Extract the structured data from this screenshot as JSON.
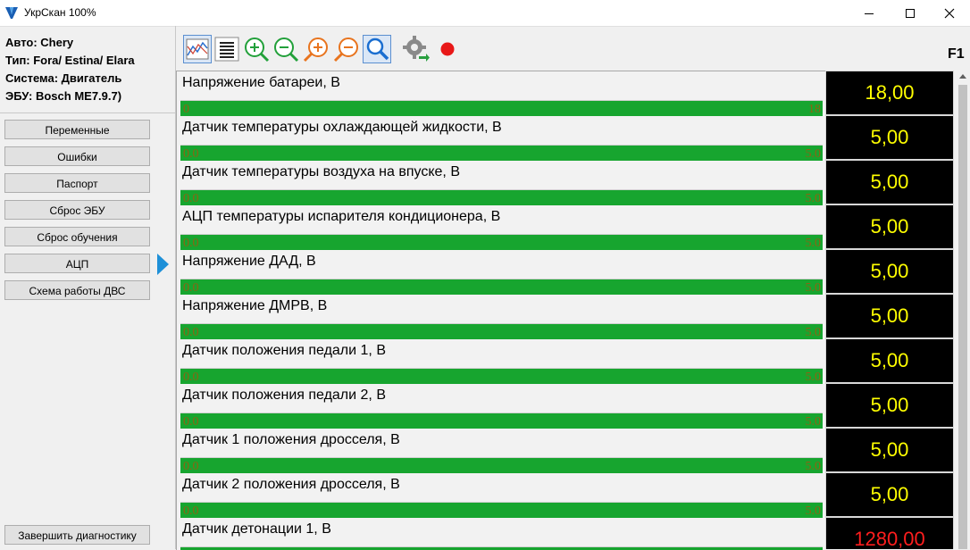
{
  "window": {
    "title": "УкрСкан 100%"
  },
  "info": {
    "auto": "Авто: Chery",
    "type": "Тип: Fora/ Estina/ Elara",
    "system": "Система: Двигатель",
    "ecu": "ЭБУ: Bosch ME7.9.7)"
  },
  "nav": {
    "items": [
      "Переменные",
      "Ошибки",
      "Паспорт",
      "Сброс ЭБУ",
      "Сброс обучения",
      "АЦП",
      "Схема работы ДВС"
    ],
    "selected_index": 5,
    "finish": "Завершить диагностику"
  },
  "toolbar": {
    "icons": [
      "graph-view-icon",
      "table-view-icon",
      "zoom-in-green-icon",
      "zoom-out-green-icon",
      "zoom-in-orange-icon",
      "zoom-out-orange-icon",
      "search-icon",
      "settings-export-icon",
      "record-icon"
    ],
    "hotkey": "F1"
  },
  "colors": {
    "bar_green": "#17a52f",
    "value_yellow": "#ffff00",
    "value_red": "#ff1e1e",
    "pointer_blue": "#1e90d8"
  },
  "rows": [
    {
      "label": "Напряжение батареи, В",
      "min": "0",
      "max": "18",
      "value": "18,00",
      "alert": false
    },
    {
      "label": "Датчик температуры охлаждающей жидкости, В",
      "min": "0.0",
      "max": "5.0",
      "value": "5,00",
      "alert": false
    },
    {
      "label": "Датчик температуры воздуха на впуске, В",
      "min": "0.0",
      "max": "5.0",
      "value": "5,00",
      "alert": false
    },
    {
      "label": "АЦП температуры испарителя кондиционера, В",
      "min": "0.0",
      "max": "5.0",
      "value": "5,00",
      "alert": false
    },
    {
      "label": "Напряжение ДАД, В",
      "min": "0.0",
      "max": "5.0",
      "value": "5,00",
      "alert": false
    },
    {
      "label": "Напряжение ДМРВ, В",
      "min": "0.0",
      "max": "5.0",
      "value": "5,00",
      "alert": false
    },
    {
      "label": "Датчик положения педали 1, В",
      "min": "0.0",
      "max": "5.0",
      "value": "5,00",
      "alert": false
    },
    {
      "label": "Датчик положения педали 2, В",
      "min": "0.0",
      "max": "5.0",
      "value": "5,00",
      "alert": false
    },
    {
      "label": "Датчик 1 положения дросселя, В",
      "min": "0.0",
      "max": "5.0",
      "value": "5,00",
      "alert": false
    },
    {
      "label": "Датчик 2 положения дросселя, В",
      "min": "0.0",
      "max": "5.0",
      "value": "5,00",
      "alert": false
    },
    {
      "label": "Датчик детонации 1, В",
      "min": "",
      "max": "",
      "value": "1280,00",
      "alert": true
    }
  ]
}
